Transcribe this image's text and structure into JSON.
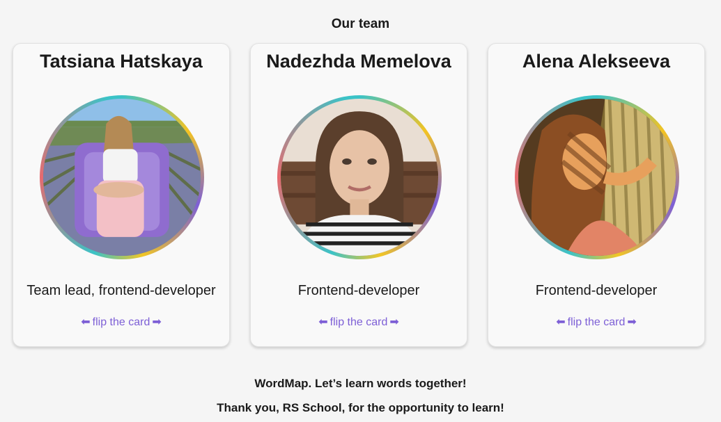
{
  "section_title": "Our team",
  "team": [
    {
      "name": "Tatsiana Hatskaya",
      "role": "Team lead, frontend-developer",
      "flip_label": "flip the card",
      "photo": "photo-woman-in-lavender-field"
    },
    {
      "name": "Nadezhda Memelova",
      "role": "Frontend-developer",
      "flip_label": "flip the card",
      "photo": "photo-woman-portrait-indoor"
    },
    {
      "name": "Alena Alekseeva",
      "role": "Frontend-developer",
      "flip_label": "flip the card",
      "photo": "photo-woman-sunlit-portrait"
    }
  ],
  "footer": {
    "line1": "WordMap. Let’s learn words together!",
    "line2": "Thank you, RS School, for the opportunity to learn!"
  },
  "colors": {
    "accent": "#7d5fd6",
    "ring_teal": "#3bc3c7",
    "ring_yellow": "#f3c322",
    "ring_red": "#e86a6f",
    "background": "#f5f5f5",
    "card": "#f9f9f9"
  }
}
